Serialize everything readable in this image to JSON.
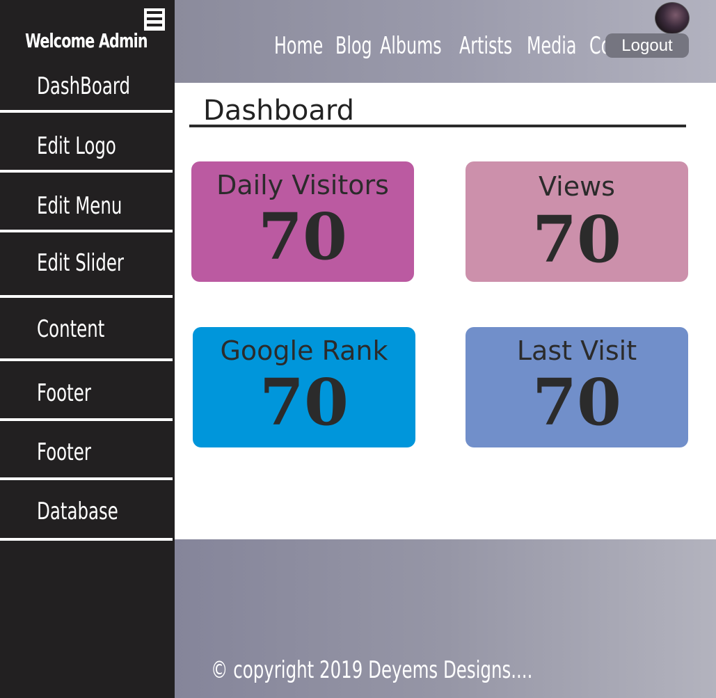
{
  "sidebar": {
    "welcome": "Welcome Admin",
    "items": [
      {
        "label": "DashBoard"
      },
      {
        "label": "Edit Logo"
      },
      {
        "label": "Edit Menu"
      },
      {
        "label": "Edit Slider"
      },
      {
        "label": "Content"
      },
      {
        "label": "Footer"
      },
      {
        "label": "Footer"
      },
      {
        "label": "Database"
      }
    ]
  },
  "header": {
    "nav": [
      "Home",
      "Blog",
      "Albums",
      "Artists",
      "Media",
      "Contact"
    ],
    "logout_label": "Logout"
  },
  "main": {
    "title": "Dashboard",
    "cards": [
      {
        "label": "Daily Visitors",
        "value": "70",
        "color": "#bb5aa1"
      },
      {
        "label": "Views",
        "value": "70",
        "color": "#cc90ab"
      },
      {
        "label": "Google Rank",
        "value": "70",
        "color": "#0096db"
      },
      {
        "label": "Last Visit",
        "value": "70",
        "color": "#718fca"
      }
    ]
  },
  "footer": {
    "copyright": "© copyright 2019 Deyems Designs...."
  },
  "colors": {
    "sidebar_bg": "#222021",
    "header_gradient_start": "#8b8b9c",
    "header_gradient_end": "#b2b2bf"
  }
}
